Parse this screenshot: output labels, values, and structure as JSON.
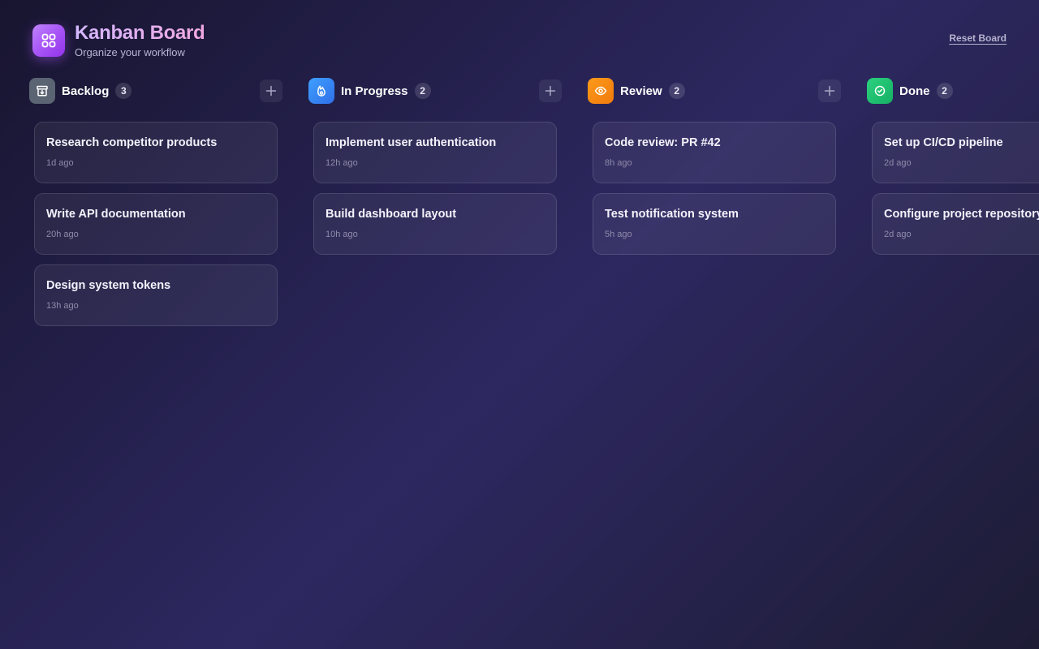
{
  "header": {
    "title": "Kanban Board",
    "subtitle": "Organize your workflow",
    "reset_label": "Reset Board"
  },
  "colors": {
    "backlog": "#5b6472",
    "in_progress": "#3b8df6",
    "review": "#f2890f",
    "done": "#1fc071"
  },
  "columns": [
    {
      "title": "Backlog",
      "count": "3",
      "icon": "archive-icon",
      "cards": [
        {
          "title": "Research competitor products",
          "time": "1d ago"
        },
        {
          "title": "Write API documentation",
          "time": "20h ago"
        },
        {
          "title": "Design system tokens",
          "time": "13h ago"
        }
      ]
    },
    {
      "title": "In Progress",
      "count": "2",
      "icon": "flame-icon",
      "cards": [
        {
          "title": "Implement user authentication",
          "time": "12h ago"
        },
        {
          "title": "Build dashboard layout",
          "time": "10h ago"
        }
      ]
    },
    {
      "title": "Review",
      "count": "2",
      "icon": "eye-icon",
      "cards": [
        {
          "title": "Code review: PR #42",
          "time": "8h ago"
        },
        {
          "title": "Test notification system",
          "time": "5h ago"
        }
      ]
    },
    {
      "title": "Done",
      "count": "2",
      "icon": "check-circle-icon",
      "cards": [
        {
          "title": "Set up CI/CD pipeline",
          "time": "2d ago"
        },
        {
          "title": "Configure project repository",
          "time": "2d ago"
        }
      ]
    }
  ]
}
